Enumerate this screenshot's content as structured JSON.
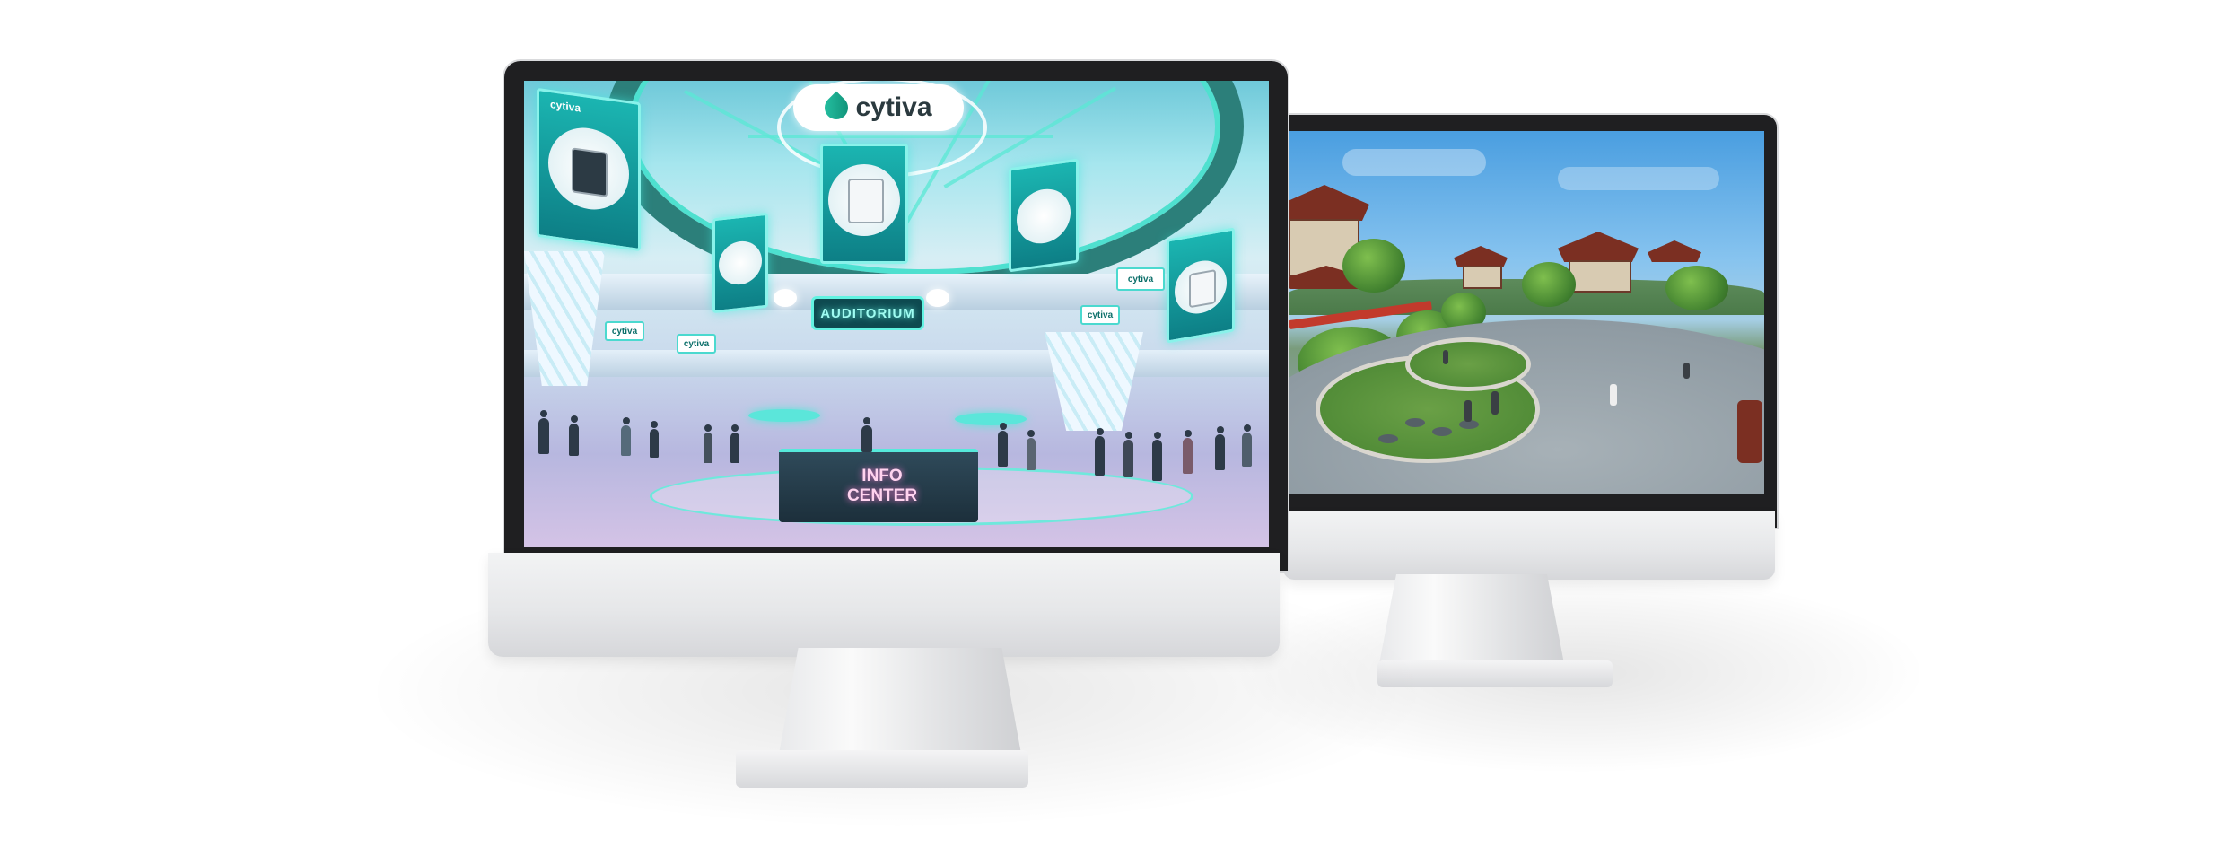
{
  "front_monitor": {
    "screen": {
      "logo_text": "cytiva",
      "small_logo_text": "cytiva",
      "auditorium_sign": "AUDITORIUM",
      "info_center_line1": "INFO",
      "info_center_line2": "CENTER",
      "wall_sign_text": "cytiva"
    }
  },
  "back_monitor": {
    "screen": {}
  },
  "colors": {
    "accent_teal": "#1bb5b1",
    "neon": "#62f3e2",
    "bezel": "#1f1f21",
    "aluminum": "#e6e7e9"
  }
}
